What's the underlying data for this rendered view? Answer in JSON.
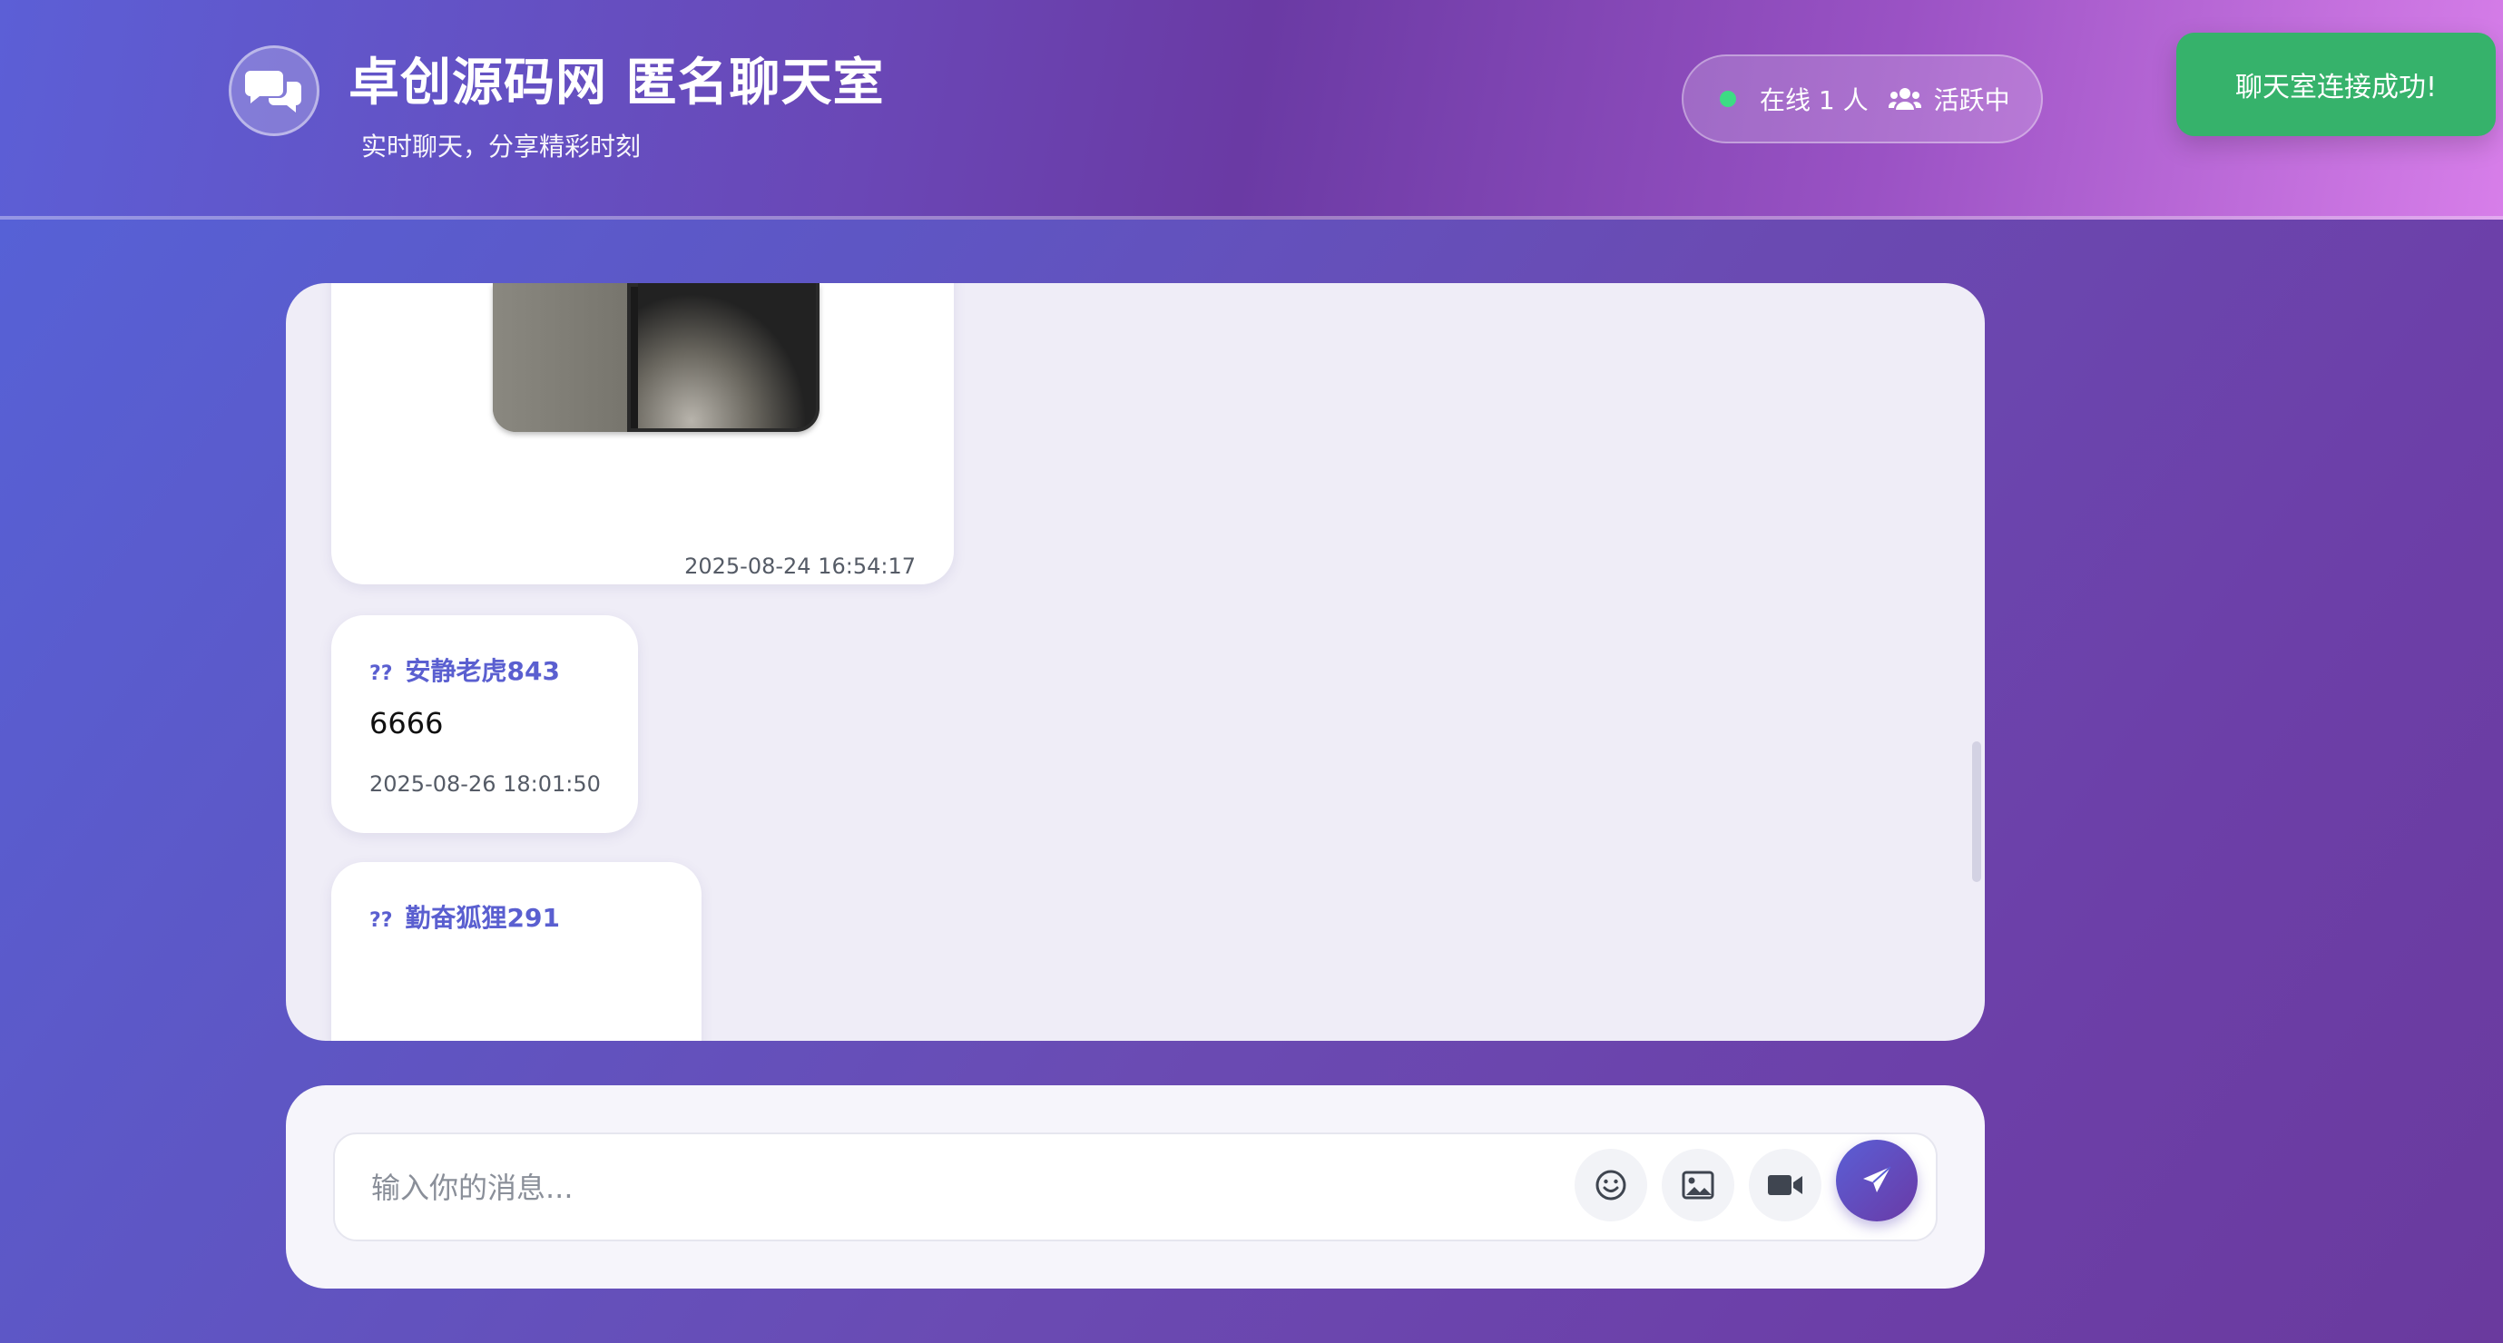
{
  "header": {
    "title": "卓创源码网 匿名聊天室",
    "subtitle": "实时聊天，分享精彩时刻",
    "online_text": "在线 1 人",
    "active_text": "活跃中",
    "logo_icon": "chat-bubbles-icon",
    "online_color": "#3ddc84"
  },
  "toast": {
    "text": "聊天室连接成功!",
    "color": "#36b26b"
  },
  "messages": [
    {
      "type": "image",
      "image_icon": "phone-photo",
      "timestamp": "2025-08-24 16:54:17"
    },
    {
      "type": "text",
      "sender_prefix": "??",
      "sender": "安静老虎843",
      "text": "6666",
      "timestamp": "2025-08-26 18:01:50"
    },
    {
      "type": "text",
      "sender_prefix": "??",
      "sender": "勤奋狐狸291"
    }
  ],
  "composer": {
    "placeholder": "输入你的消息...",
    "emoji_icon": "smile-icon",
    "image_icon": "image-icon",
    "video_icon": "video-camera-icon",
    "send_icon": "paper-plane-icon",
    "accent_color": "#5a5fd6"
  }
}
